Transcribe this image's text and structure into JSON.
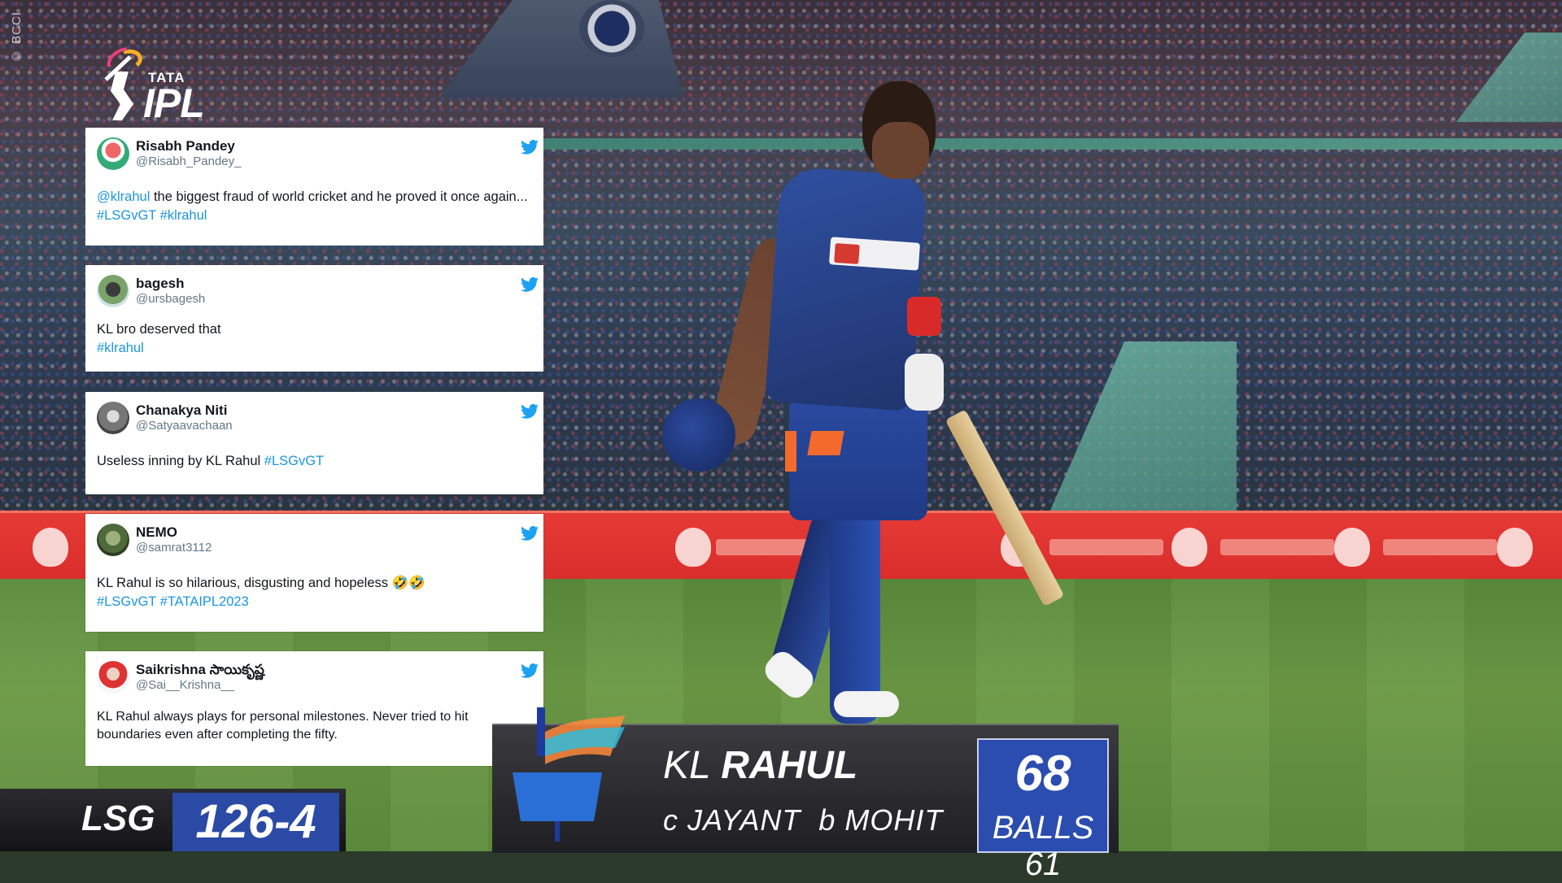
{
  "watermark": "© BCCI",
  "ipl_logo": {
    "brand": "TATA",
    "name": "IPL"
  },
  "tweets": [
    {
      "name": "Risabh Pandey",
      "handle": "@Risabh_Pandey_",
      "mention": "@klrahul",
      "text": " the biggest fraud of world cricket and he proved it once again...",
      "hashtags": "#LSGvGT #klrahul"
    },
    {
      "name": "bagesh",
      "handle": "@ursbagesh",
      "text": "KL bro deserved that",
      "hashtags": "#klrahul"
    },
    {
      "name": "Chanakya Niti",
      "handle": "@Satyaavachaan",
      "text": "Useless inning by KL Rahul ",
      "hashtags": "#LSGvGT"
    },
    {
      "name": "NEMO",
      "handle": "@samrat3112",
      "text": "KL Rahul is so hilarious, disgusting and hopeless 🤣🤣",
      "hashtags": "#LSGvGT #TATAIPL2023"
    },
    {
      "name": "Saikrishna సాయికృష్ణ",
      "handle": "@Sai__Krishna__",
      "text": "KL Rahul always plays for personal milestones. Never tried to hit boundaries even after completing the fifty."
    }
  ],
  "scoreboard": {
    "team": "LSG",
    "score": "126-4"
  },
  "batter_card": {
    "first": "KL",
    "last": "RAHUL",
    "dismissal": "c JAYANT  b MOHIT",
    "runs": "68",
    "balls": "BALLS 61"
  },
  "colors": {
    "twitter_blue": "#1b95e0",
    "lsg_blue": "#2b4db0",
    "ad_red": "#e63a35"
  },
  "icons": [
    "twitter-bird-icon",
    "ipl-logo",
    "lsg-logo"
  ]
}
